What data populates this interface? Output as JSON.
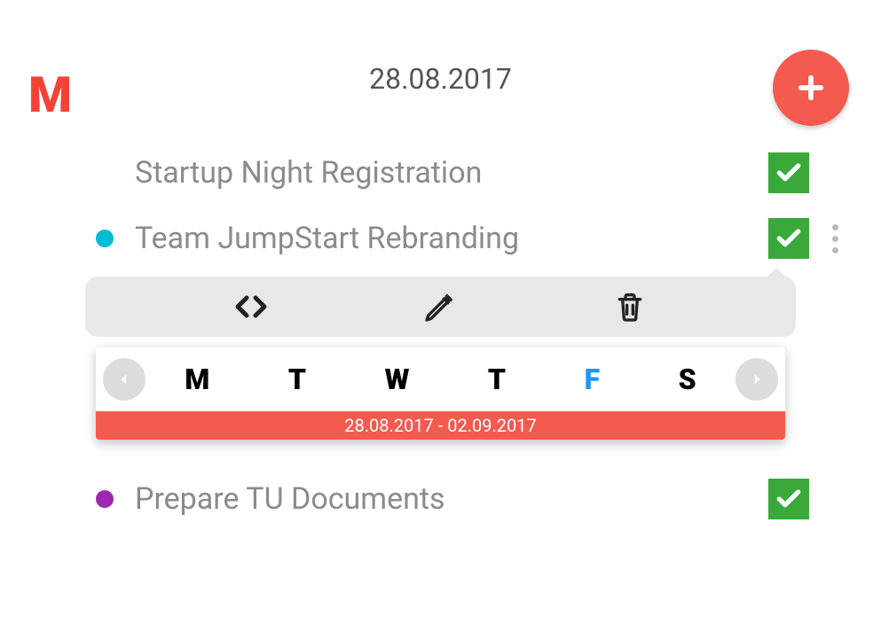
{
  "header": {
    "logo": "M",
    "date": "28.08.2017"
  },
  "tasks": [
    {
      "title": "Startup Night Registration",
      "checked": true,
      "dot": null,
      "expanded": false
    },
    {
      "title": "Team JumpStart Rebranding",
      "checked": true,
      "dot": "cyan",
      "expanded": true
    },
    {
      "title": "Prepare TU Documents",
      "checked": true,
      "dot": "purple",
      "expanded": false
    }
  ],
  "week": {
    "days": [
      "M",
      "T",
      "W",
      "T",
      "F",
      "S"
    ],
    "active_index": 4,
    "range": "28.08.2017 - 02.09.2017"
  }
}
